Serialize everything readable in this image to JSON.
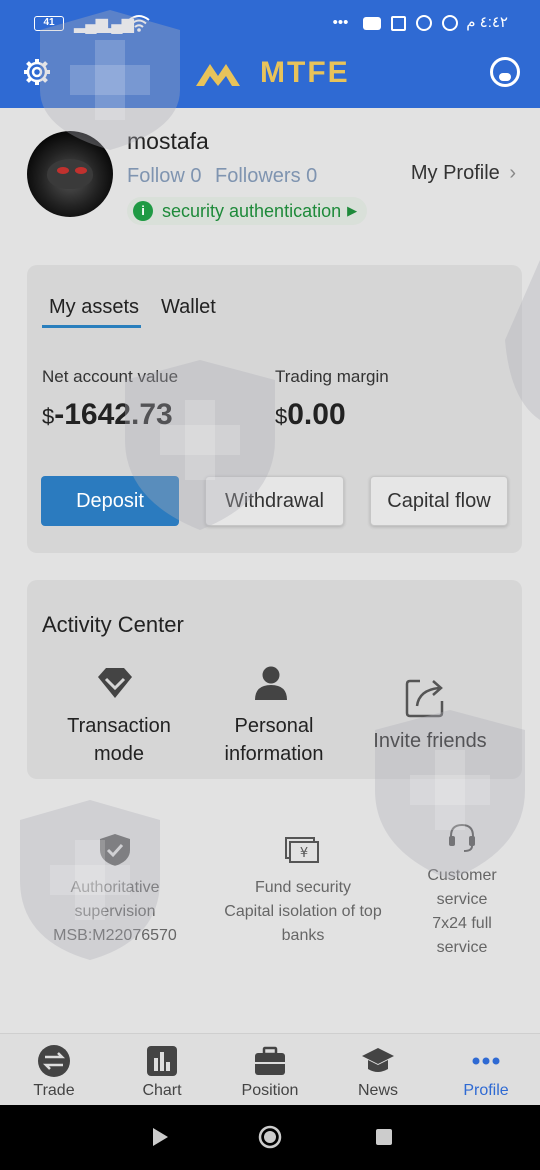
{
  "status_bar": {
    "battery": "41",
    "time": "٤:٤٢ م",
    "dots": "•••"
  },
  "header": {
    "brand": "MTFE",
    "settings_icon": "gear-icon",
    "support_icon": "customer-support-icon"
  },
  "profile": {
    "username": "mostafa",
    "follow": "Follow 0",
    "followers": "Followers 0",
    "my_profile": "My Profile",
    "security": "security authentication"
  },
  "assets": {
    "tabs": [
      "My assets",
      "Wallet"
    ],
    "active_tab": "My assets",
    "net_label": "Net account value",
    "net_currency": "$",
    "net_value": "-1642.73",
    "margin_label": "Trading margin",
    "margin_currency": "$",
    "margin_value": "0.00",
    "buttons": [
      "Deposit",
      "Withdrawal",
      "Capital flow"
    ]
  },
  "activity": {
    "title": "Activity Center",
    "items": [
      {
        "line1": "Transaction",
        "line2": "mode",
        "icon": "diamond-icon"
      },
      {
        "line1": "Personal",
        "line2": "information",
        "icon": "person-icon"
      },
      {
        "line1": "Invite friends",
        "line2": "",
        "icon": "share-icon"
      }
    ]
  },
  "features": [
    {
      "lines": [
        "Authoritative",
        "supervision",
        "MSB:M22076570"
      ],
      "icon": "shield-check-icon"
    },
    {
      "lines": [
        "Fund security",
        "Capital isolation of top",
        "banks"
      ],
      "icon": "money-icon"
    },
    {
      "lines": [
        "Customer",
        "service",
        "7x24 full",
        "service"
      ],
      "icon": "headset-icon"
    }
  ],
  "bottom_nav": [
    {
      "label": "Trade",
      "icon": "exchange-icon"
    },
    {
      "label": "Chart",
      "icon": "bar-chart-icon"
    },
    {
      "label": "Position",
      "icon": "briefcase-icon"
    },
    {
      "label": "News",
      "icon": "graduation-cap-icon"
    },
    {
      "label": "Profile",
      "icon": "more-dots-icon"
    }
  ],
  "active_nav": "Profile",
  "colors": {
    "header": "#2f6ad3",
    "accent": "#2b7bbf",
    "success": "#1f9a44"
  }
}
